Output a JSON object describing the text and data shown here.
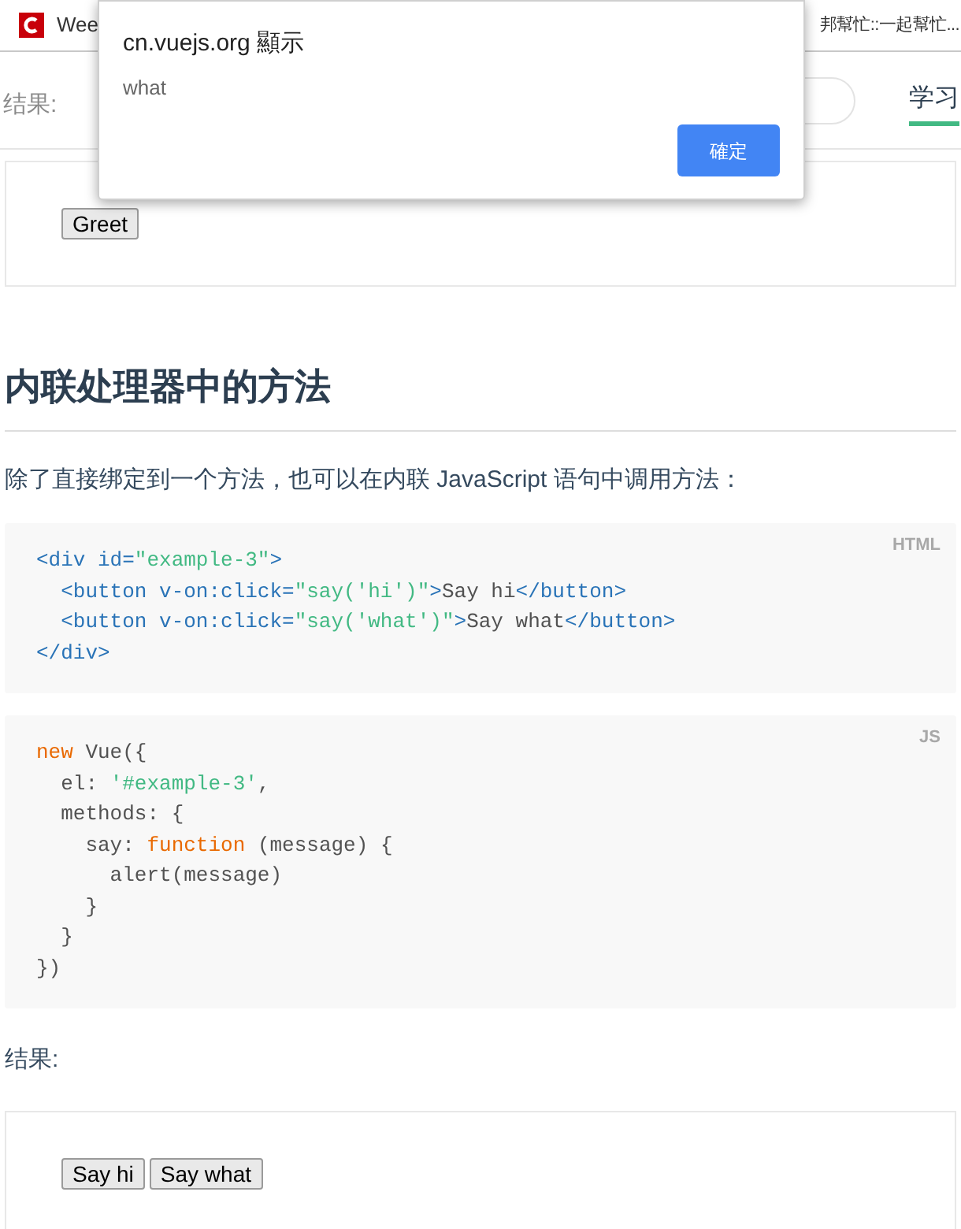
{
  "tab_bar": {
    "tab_title": "Wee",
    "bookmark_text": "邦幫忙::一起幫忙..."
  },
  "site_header": {
    "label": "结果:",
    "nav": [
      {
        "label": "学习",
        "selected": true
      }
    ]
  },
  "dialog": {
    "title": "cn.vuejs.org 顯示",
    "message": "what",
    "button": "確定"
  },
  "demo_1": {
    "buttons": [
      "Greet"
    ]
  },
  "heading": "内联处理器中的方法",
  "paragraph": "除了直接绑定到一个方法，也可以在内联 JavaScript 语句中调用方法：",
  "code_blocks": [
    {
      "language": "HTML",
      "lines": [
        [
          {
            "kind": "tag",
            "text": "<div id="
          },
          {
            "kind": "string",
            "text": "\"example-3\""
          },
          {
            "kind": "tag",
            "text": ">"
          }
        ],
        [
          {
            "kind": "tag",
            "text": "  <button v-on:click="
          },
          {
            "kind": "string",
            "text": "\"say('hi')\""
          },
          {
            "kind": "tag",
            "text": ">"
          },
          {
            "kind": "plain",
            "text": "Say hi"
          },
          {
            "kind": "tag",
            "text": "</button>"
          }
        ],
        [
          {
            "kind": "tag",
            "text": "  <button v-on:click="
          },
          {
            "kind": "string",
            "text": "\"say('what')\""
          },
          {
            "kind": "tag",
            "text": ">"
          },
          {
            "kind": "plain",
            "text": "Say what"
          },
          {
            "kind": "tag",
            "text": "</button>"
          }
        ],
        [
          {
            "kind": "tag",
            "text": "</div>"
          }
        ]
      ]
    },
    {
      "language": "JS",
      "lines": [
        [
          {
            "kind": "keyword",
            "text": "new"
          },
          {
            "kind": "plain",
            "text": " Vue({"
          }
        ],
        [
          {
            "kind": "plain",
            "text": "  el: "
          },
          {
            "kind": "string",
            "text": "'#example-3'"
          },
          {
            "kind": "plain",
            "text": ","
          }
        ],
        [
          {
            "kind": "plain",
            "text": "  methods: {"
          }
        ],
        [
          {
            "kind": "plain",
            "text": "    say: "
          },
          {
            "kind": "keyword",
            "text": "function"
          },
          {
            "kind": "plain",
            "text": " (message) {"
          }
        ],
        [
          {
            "kind": "plain",
            "text": "      alert(message)"
          }
        ],
        [
          {
            "kind": "plain",
            "text": "    }"
          }
        ],
        [
          {
            "kind": "plain",
            "text": "  }"
          }
        ],
        [
          {
            "kind": "plain",
            "text": "})"
          }
        ]
      ]
    }
  ],
  "result_label": "结果:",
  "demo_2": {
    "buttons": [
      "Say hi",
      "Say what"
    ]
  }
}
